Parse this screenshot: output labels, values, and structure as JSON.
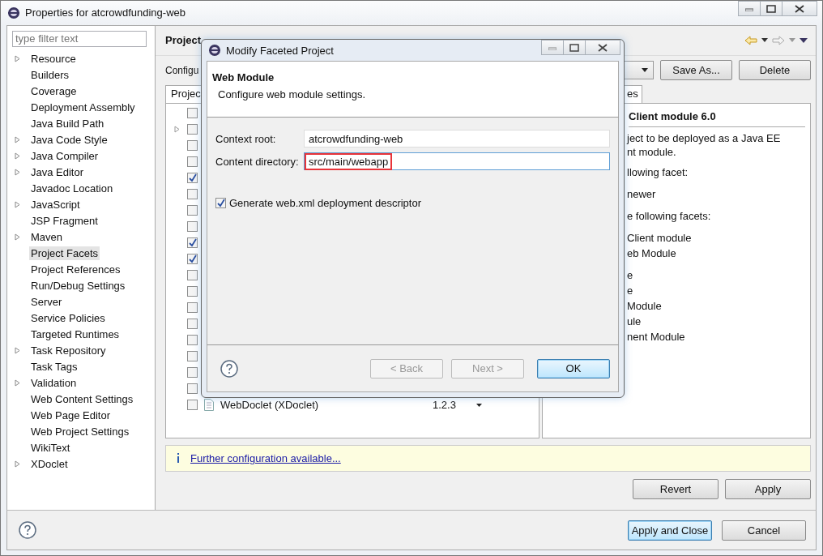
{
  "window": {
    "title": "Properties for atcrowdfunding-web"
  },
  "sidebar": {
    "filter": {
      "placeholder": "type filter text"
    },
    "items": [
      {
        "label": "Resource",
        "expandable": true,
        "selected": false
      },
      {
        "label": "Builders",
        "expandable": false,
        "selected": false
      },
      {
        "label": "Coverage",
        "expandable": false,
        "selected": false
      },
      {
        "label": "Deployment Assembly",
        "expandable": false,
        "selected": false
      },
      {
        "label": "Java Build Path",
        "expandable": false,
        "selected": false
      },
      {
        "label": "Java Code Style",
        "expandable": true,
        "selected": false
      },
      {
        "label": "Java Compiler",
        "expandable": true,
        "selected": false
      },
      {
        "label": "Java Editor",
        "expandable": true,
        "selected": false
      },
      {
        "label": "Javadoc Location",
        "expandable": false,
        "selected": false
      },
      {
        "label": "JavaScript",
        "expandable": true,
        "selected": false
      },
      {
        "label": "JSP Fragment",
        "expandable": false,
        "selected": false
      },
      {
        "label": "Maven",
        "expandable": true,
        "selected": false
      },
      {
        "label": "Project Facets",
        "expandable": false,
        "selected": true
      },
      {
        "label": "Project References",
        "expandable": false,
        "selected": false
      },
      {
        "label": "Run/Debug Settings",
        "expandable": false,
        "selected": false
      },
      {
        "label": "Server",
        "expandable": false,
        "selected": false
      },
      {
        "label": "Service Policies",
        "expandable": false,
        "selected": false
      },
      {
        "label": "Targeted Runtimes",
        "expandable": false,
        "selected": false
      },
      {
        "label": "Task Repository",
        "expandable": true,
        "selected": false
      },
      {
        "label": "Task Tags",
        "expandable": false,
        "selected": false
      },
      {
        "label": "Validation",
        "expandable": true,
        "selected": false
      },
      {
        "label": "Web Content Settings",
        "expandable": false,
        "selected": false
      },
      {
        "label": "Web Page Editor",
        "expandable": false,
        "selected": false
      },
      {
        "label": "Web Project Settings",
        "expandable": false,
        "selected": false
      },
      {
        "label": "WikiText",
        "expandable": false,
        "selected": false
      },
      {
        "label": "XDoclet",
        "expandable": true,
        "selected": false
      }
    ]
  },
  "page": {
    "title": "Project",
    "config_label": "Configu",
    "buttons": [
      "Save As...",
      "Delete"
    ],
    "facets_tab": "Projec",
    "details_tab": "es",
    "facets": [
      {
        "checked": false,
        "expandable": false
      },
      {
        "checked": false,
        "expandable": true
      },
      {
        "checked": false,
        "expandable": false
      },
      {
        "checked": false,
        "expandable": false
      },
      {
        "checked": true,
        "expandable": false
      },
      {
        "checked": false,
        "expandable": false
      },
      {
        "checked": false,
        "expandable": false
      },
      {
        "checked": false,
        "expandable": false
      },
      {
        "checked": true,
        "expandable": false
      },
      {
        "checked": true,
        "expandable": false
      },
      {
        "checked": false,
        "expandable": false
      },
      {
        "checked": false,
        "expandable": false
      },
      {
        "checked": false,
        "expandable": false
      },
      {
        "checked": false,
        "expandable": false
      },
      {
        "checked": false,
        "expandable": false
      },
      {
        "checked": false,
        "expandable": false
      },
      {
        "checked": false,
        "expandable": false
      },
      {
        "checked": false,
        "expandable": false
      },
      {
        "checked": false,
        "expandable": false,
        "name": "WebDoclet (XDoclet)",
        "version": "1.2.3"
      }
    ],
    "details": {
      "title": "Client module 6.0",
      "paragraphs": [
        [
          "ject to be deployed as a Java EE",
          "nt module."
        ],
        [
          "llowing facet:"
        ],
        [
          "newer"
        ],
        [
          "e following facets:"
        ],
        [
          "Client module",
          "eb Module"
        ],
        [
          "e",
          "e",
          "Module",
          "ule",
          "nent Module"
        ]
      ]
    },
    "info": "Further configuration available...",
    "actions": [
      "Revert",
      "Apply"
    ]
  },
  "footer": {
    "buttons": [
      {
        "label": "Apply and Close",
        "default": true
      },
      {
        "label": "Cancel",
        "default": false
      }
    ]
  },
  "dialog": {
    "title": "Modify Faceted Project",
    "heading": "Web Module",
    "description": "Configure web module settings.",
    "fields": [
      {
        "label": "Context root:",
        "value": "atcrowdfunding-web",
        "highlighted": false,
        "focused": false
      },
      {
        "label": "Content directory:",
        "value": "src/main/webapp",
        "highlighted": true,
        "focused": true
      }
    ],
    "checkbox": {
      "label": "Generate web.xml deployment descriptor",
      "checked": true
    },
    "buttons": [
      {
        "label": "< Back",
        "disabled": true,
        "default": false
      },
      {
        "label": "Next >",
        "disabled": true,
        "default": false
      },
      {
        "label": "OK",
        "disabled": false,
        "default": true
      }
    ]
  }
}
